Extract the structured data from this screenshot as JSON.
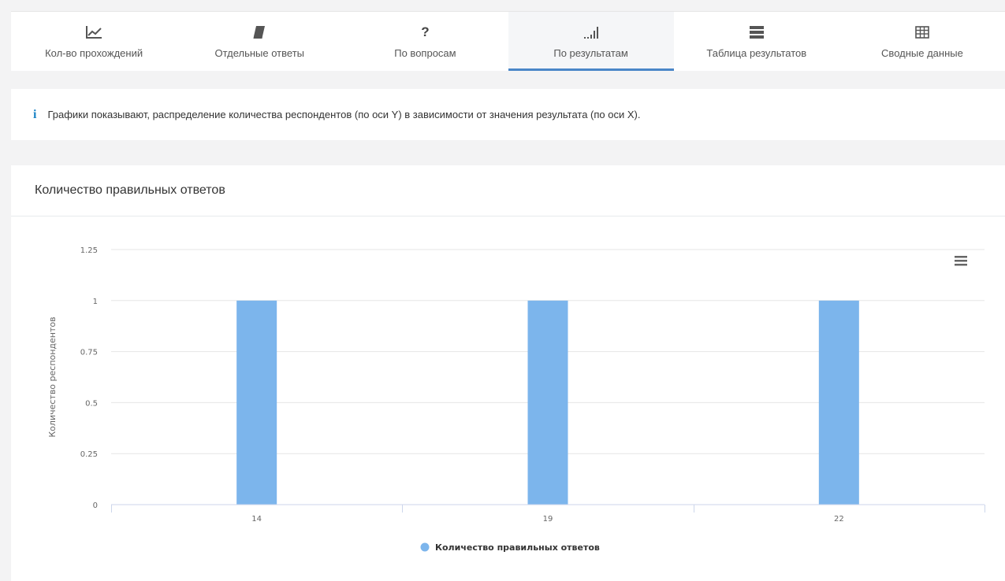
{
  "tabs": [
    {
      "label": "Кол-во прохождений",
      "icon": "line-chart-icon",
      "active": false
    },
    {
      "label": "Отдельные ответы",
      "icon": "book-icon",
      "active": false
    },
    {
      "label": "По вопросам",
      "icon": "question-icon",
      "active": false
    },
    {
      "label": "По результатам",
      "icon": "signal-bars-icon",
      "active": true
    },
    {
      "label": "Таблица результатов",
      "icon": "server-icon",
      "active": false
    },
    {
      "label": "Сводные данные",
      "icon": "table-icon",
      "active": false
    }
  ],
  "question_glyph": "?",
  "info": {
    "icon_glyph": "i",
    "text": "Графики показывают, распределение количества респондентов (по оси Y) в зависимости от значения результата (по оси X)."
  },
  "panel": {
    "title": "Количество правильных ответов"
  },
  "colors": {
    "bar": "#7cb5ec",
    "accent": "#4a86c8",
    "info_icon": "#1c84c6"
  },
  "chart_data": {
    "type": "bar",
    "title": "",
    "xlabel": "",
    "ylabel": "Количество респондентов",
    "categories": [
      "14",
      "19",
      "22"
    ],
    "series": [
      {
        "name": "Количество правильных ответов",
        "values": [
          1,
          1,
          1
        ]
      }
    ],
    "ylim": [
      0,
      1.25
    ],
    "yticks": [
      "0",
      "0.25",
      "0.5",
      "0.75",
      "1",
      "1.25"
    ],
    "grid": true,
    "legend": "bottom-center"
  }
}
